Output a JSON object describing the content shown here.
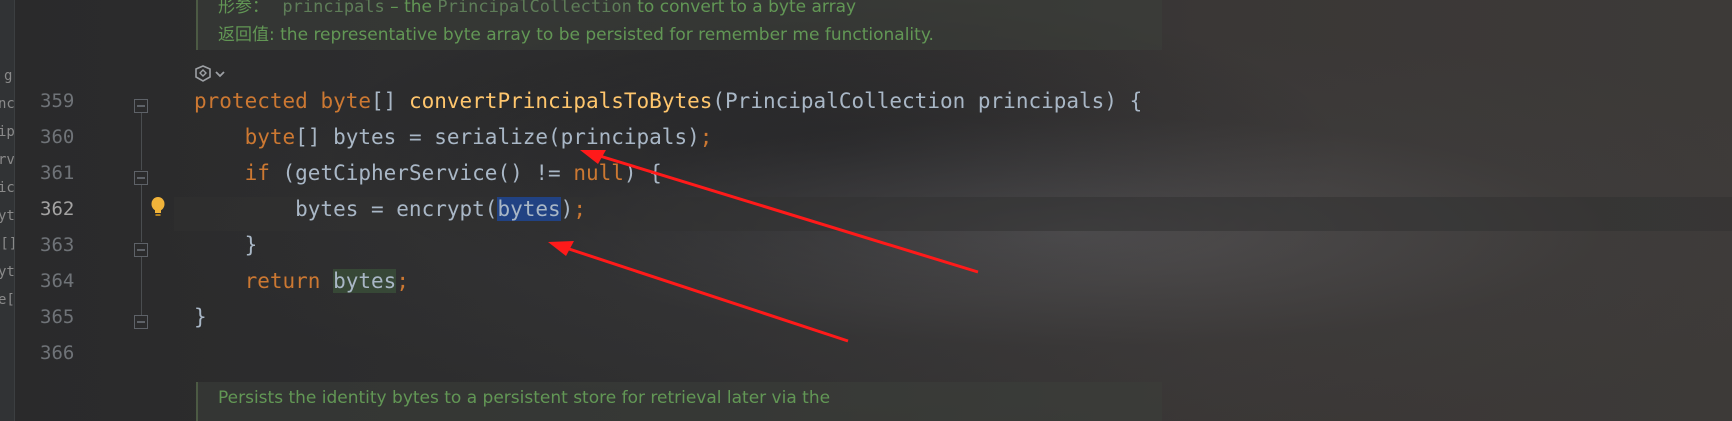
{
  "doc_top": {
    "param_prefix": "形参：",
    "param_name": "principals",
    "param_text": " – the ",
    "param_type": "PrincipalCollection",
    "param_tail": " to convert to a byte array",
    "return_prefix": "返回值:",
    "return_text": " the representative byte array to be persisted for remember me functionality."
  },
  "doc_bottom": {
    "line1": "Persists the identity bytes to a persistent store for retrieval later via the"
  },
  "ai_icon": "ai-assistant-icon",
  "left_strip_chars": [
    "g",
    "nc",
    "ip",
    "rv",
    "ic",
    "yt",
    "e[]",
    "yt",
    "e["
  ],
  "lines": [
    {
      "num": "359",
      "tokens": [
        {
          "t": "protected ",
          "c": "kw"
        },
        {
          "t": "byte",
          "c": "kw"
        },
        {
          "t": "[] ",
          "c": "plain"
        },
        {
          "t": "convertPrincipalsToBytes",
          "c": "fn"
        },
        {
          "t": "(PrincipalCollection principals) {",
          "c": "plain"
        }
      ]
    },
    {
      "num": "360",
      "tokens": [
        {
          "t": "    ",
          "c": "plain"
        },
        {
          "t": "byte",
          "c": "kw"
        },
        {
          "t": "[] bytes = serialize(principals)",
          "c": "plain"
        },
        {
          "t": ";",
          "c": "kw"
        }
      ]
    },
    {
      "num": "361",
      "tokens": [
        {
          "t": "    ",
          "c": "plain"
        },
        {
          "t": "if ",
          "c": "kw"
        },
        {
          "t": "(getCipherService() != ",
          "c": "plain"
        },
        {
          "t": "null",
          "c": "kw"
        },
        {
          "t": ") {",
          "c": "plain"
        }
      ]
    },
    {
      "num": "362",
      "tokens": [
        {
          "t": "        bytes = encrypt(",
          "c": "plain"
        },
        {
          "t": "bytes",
          "c": "plain sel"
        },
        {
          "t": ")",
          "c": "plain"
        },
        {
          "t": ";",
          "c": "kw"
        }
      ]
    },
    {
      "num": "363",
      "tokens": [
        {
          "t": "    }",
          "c": "plain"
        }
      ]
    },
    {
      "num": "364",
      "tokens": [
        {
          "t": "    ",
          "c": "plain"
        },
        {
          "t": "return ",
          "c": "kw"
        },
        {
          "t": "bytes",
          "c": "plain hl"
        },
        {
          "t": ";",
          "c": "kw"
        }
      ]
    },
    {
      "num": "365",
      "tokens": [
        {
          "t": "}",
          "c": "plain"
        }
      ]
    },
    {
      "num": "366",
      "tokens": []
    }
  ],
  "current_line": "362",
  "colors": {
    "keyword": "#cc7832",
    "function": "#ffc66d",
    "text": "#a9b7c6",
    "doc": "#629755",
    "selection": "#214283",
    "arrow": "#ff1a1a"
  }
}
